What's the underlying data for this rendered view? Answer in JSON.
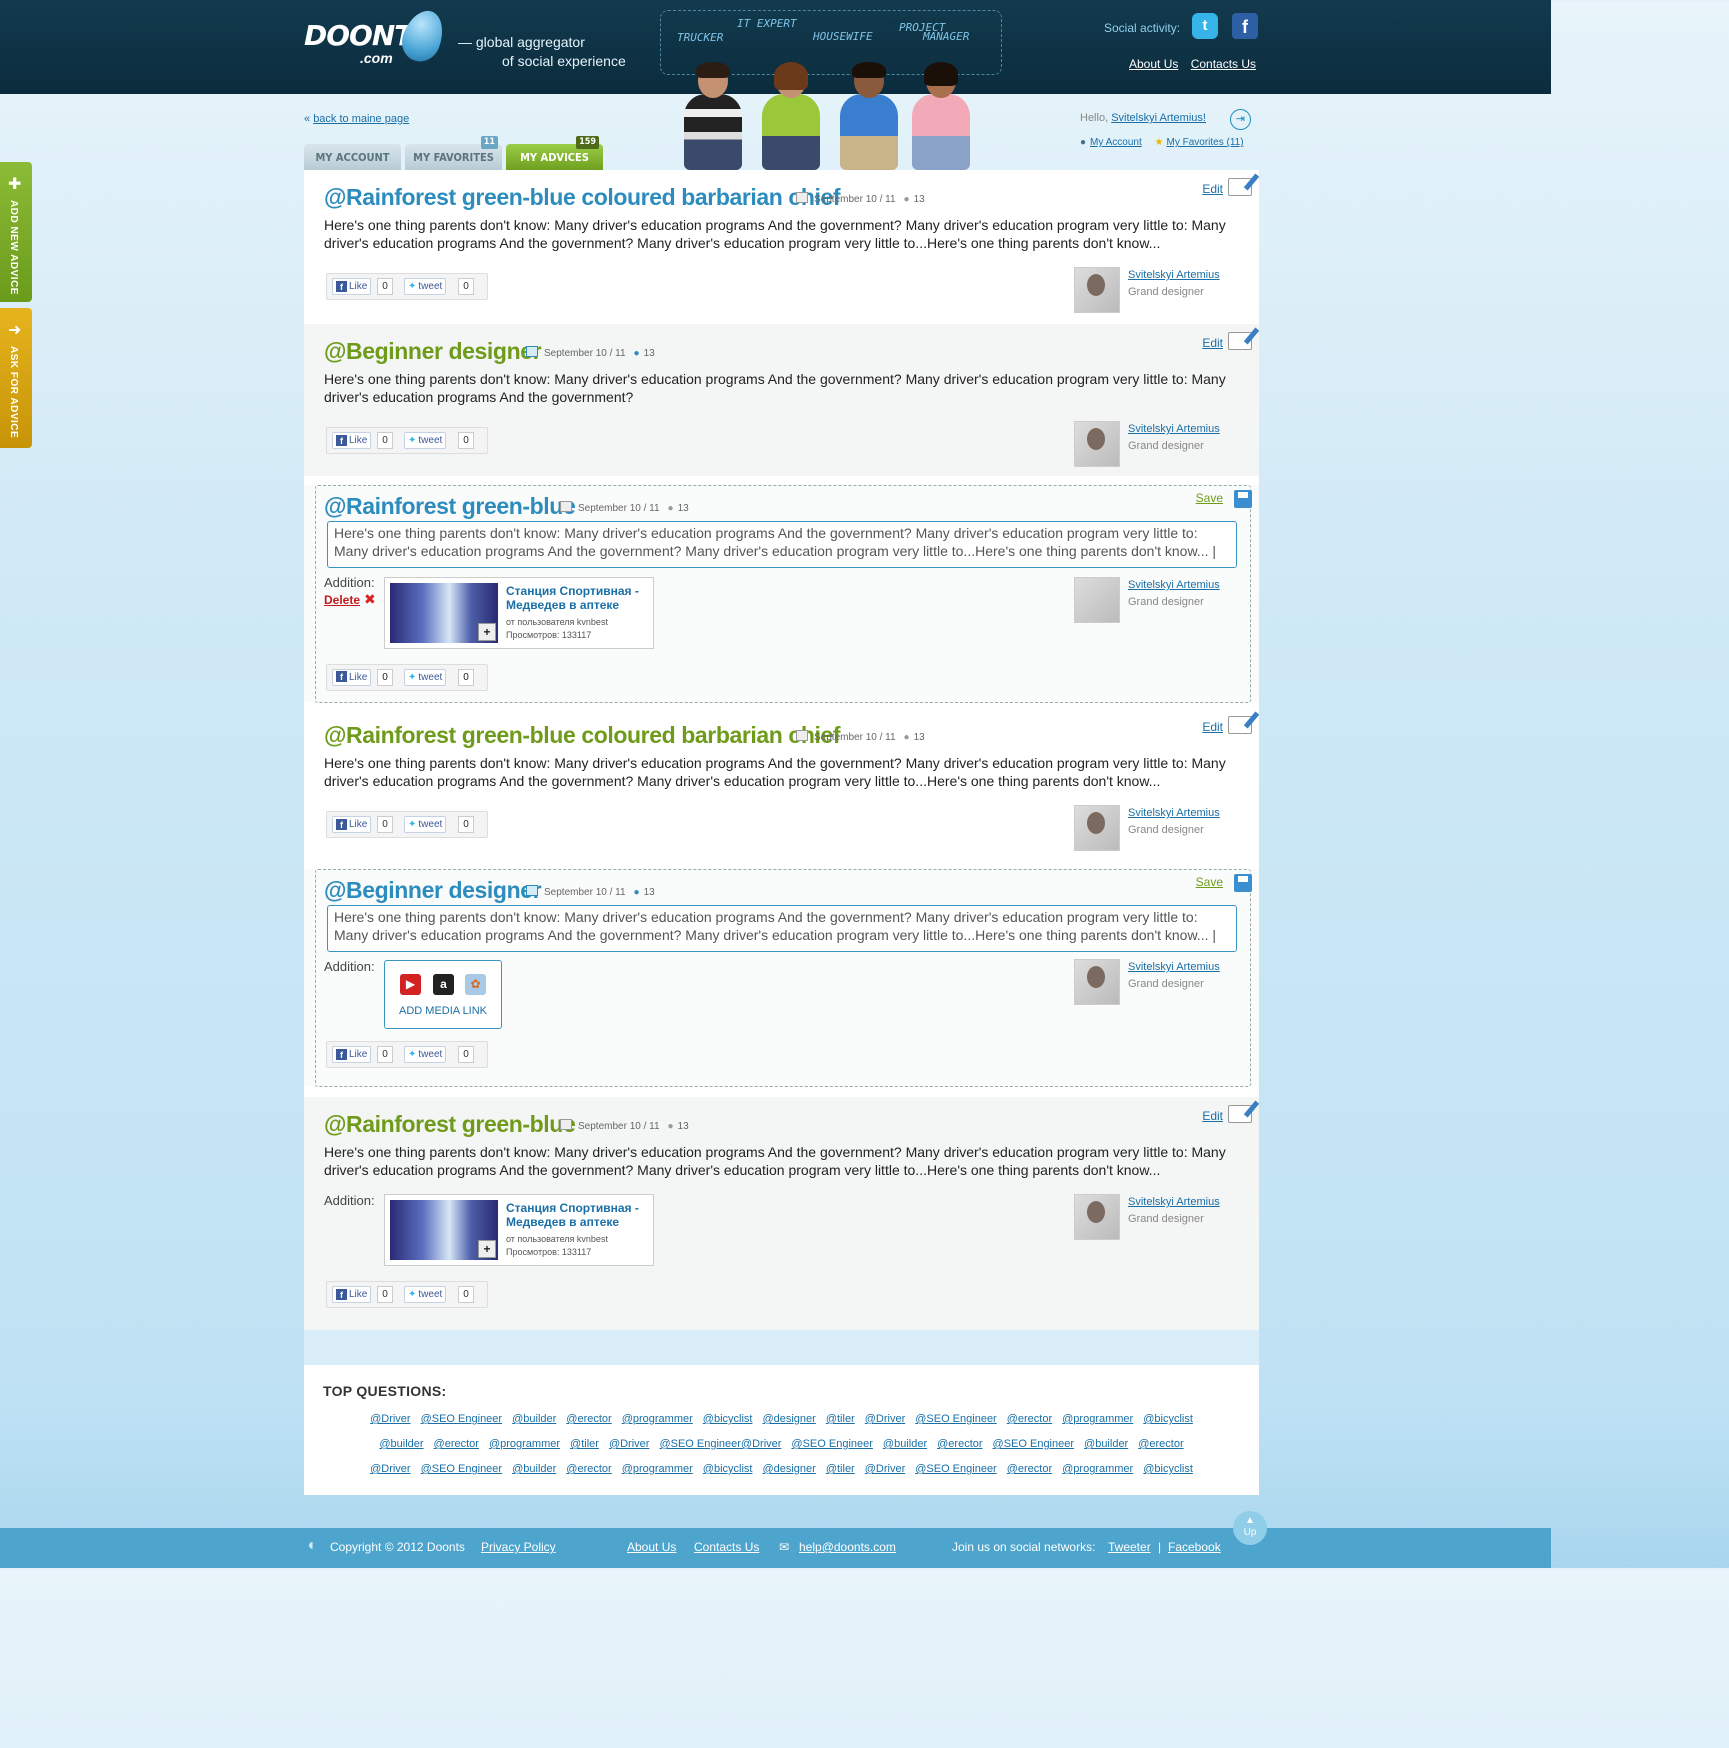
{
  "header": {
    "logo_main": "DOONTS",
    "logo_sub": ".com",
    "tagline_1": "— global aggregator",
    "tagline_2": "of social experience",
    "roles": [
      "TRUCKER",
      "IT EXPERT",
      "HOUSEWIFE",
      "PROJECT",
      "MANAGER"
    ],
    "social_label": "Social activity:",
    "twitter_glyph": "t",
    "facebook_glyph": "f",
    "nav": [
      "About Us",
      "Contacts Us"
    ]
  },
  "side_tabs": {
    "add": "ADD NEW ADVICE",
    "ask": "ASK FOR ADVICE"
  },
  "user": {
    "back_link": "back to maine page",
    "back_prefix": "«",
    "hello": "Hello,",
    "name": "Svitelskyi Artemius!",
    "my_account": "My Account",
    "my_favorites": "My Favorites (11)"
  },
  "tabs": [
    {
      "label": "MY ACCOUNT",
      "badge": ""
    },
    {
      "label": "MY FAVORITES",
      "badge": "11"
    },
    {
      "label": "MY ADVICES",
      "badge": "159"
    }
  ],
  "advice_common": {
    "date": "September 10 / 11",
    "comments": "13",
    "edit": "Edit",
    "save": "Save",
    "author": "Svitelskyi Artemius",
    "role": "Grand designer",
    "like": "Like",
    "tweet": "tweet",
    "count": "0",
    "addition": "Addition:",
    "delete": "Delete",
    "add_media": "ADD MEDIA LINK"
  },
  "advices": [
    {
      "title": "@Rainforest green-blue coloured barbarian chief",
      "body": "Here's one thing parents don't know: Many driver's education programs  And the government? Many driver's education program very little to: Many driver's education programs And the government? Many driver's education program very little to...Here's one thing parents don't know..."
    },
    {
      "title": "@Beginner designer",
      "body": "Here's one thing parents don't know: Many driver's education programs  And the government? Many driver's education program very little to: Many driver's education programs And the government?"
    },
    {
      "title": "@Rainforest green-blue",
      "body": "Here's one thing parents don't know: Many driver's education programs  And the government? Many driver's education program very little to: Many driver's education programs And the government? Many driver's education program very little to...Here's one thing parents don't know... |"
    },
    {
      "title": "@Rainforest green-blue coloured barbarian chief",
      "body": "Here's one thing parents don't know: Many driver's education programs  And the government? Many driver's education program very little to: Many driver's education programs And the government? Many driver's education program very little to...Here's one thing parents don't know..."
    },
    {
      "title": "@Beginner designer",
      "body": "Here's one thing parents don't know: Many driver's education programs  And the government? Many driver's education program very little to: Many driver's education programs And the government? Many driver's education program very little to...Here's one thing parents don't know... |"
    },
    {
      "title": "@Rainforest green-blue",
      "body": "Here's one thing parents don't know: Many driver's education programs  And the government? Many driver's education program very little to: Many driver's education programs And the government? Many driver's education program very little to...Here's one thing parents don't know..."
    }
  ],
  "video": {
    "title": "Станция Спортивная - Медведев в аптеке",
    "by": "от пользователя kvnbest",
    "views": "Просмотров: 133117"
  },
  "top_questions": {
    "title": "TOP QUESTIONS:",
    "row1": [
      "@Driver",
      "@SEO Engineer",
      "@builder",
      "@erector",
      "@programmer",
      "@bicyclist",
      "@designer",
      "@tiler",
      "@Driver",
      "@SEO Engineer",
      "@erector",
      "@programmer",
      "@bicyclist"
    ],
    "row2": [
      "@builder",
      "@erector",
      "@programmer",
      "@tiler",
      "@Driver",
      "@SEO Engineer@Driver",
      "@SEO Engineer",
      "@builder",
      "@erector",
      "@SEO Engineer",
      "@builder",
      "@erector"
    ],
    "row3": [
      "@Driver",
      "@SEO Engineer",
      "@builder",
      "@erector",
      "@programmer",
      "@bicyclist",
      "@designer",
      "@tiler",
      "@Driver",
      "@SEO Engineer",
      "@erector",
      "@programmer",
      "@bicyclist"
    ]
  },
  "footer": {
    "copyright": "Copyright © 2012 Doonts",
    "privacy": "Privacy Policy",
    "about": "About Us",
    "contacts": "Contacts Us",
    "email": "help@doonts.com",
    "join": "Join us on social networks:",
    "tweeter": "Tweeter",
    "sep": "|",
    "facebook": "Facebook",
    "up": "Up"
  },
  "colors": {
    "header_bg": "#0b2c3d",
    "title_blue": "#2b8cbd",
    "title_green": "#6f9b1a",
    "link": "#1a6fa6",
    "footer_bg": "#4da4cd"
  }
}
